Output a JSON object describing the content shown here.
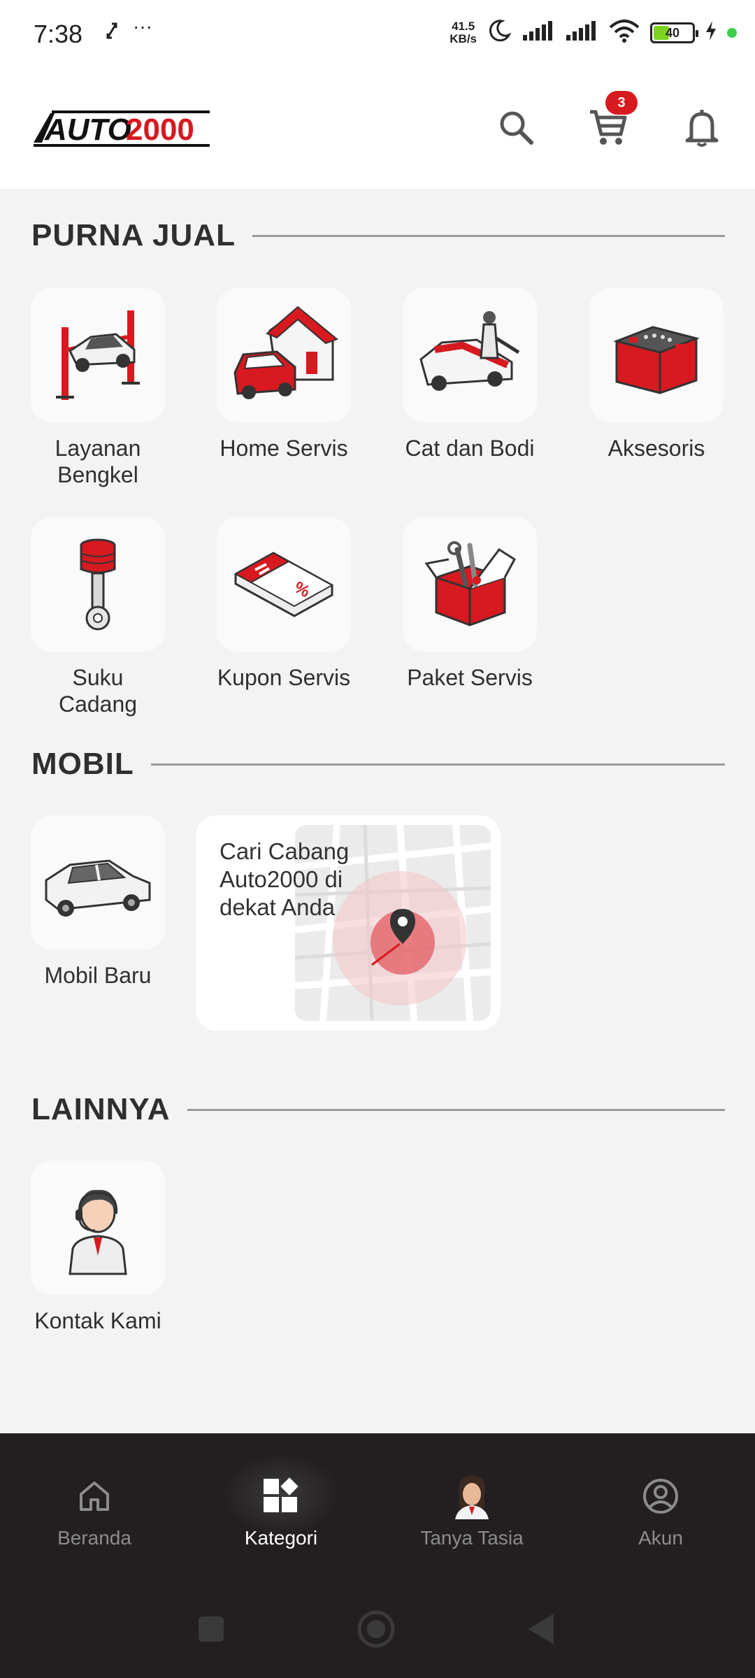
{
  "status_bar": {
    "time": "7:38",
    "net_speed_value": "41.5",
    "net_speed_unit": "KB/s",
    "battery": "40"
  },
  "header": {
    "logo_text_1": "AUTO",
    "logo_text_2": "2000",
    "cart_count": "3",
    "brand_color": "#d71920"
  },
  "sections": {
    "purna_jual": {
      "title": "PURNA JUAL",
      "items": [
        {
          "label": "Layanan Bengkel",
          "icon": "car-lift-icon"
        },
        {
          "label": "Home Servis",
          "icon": "home-service-icon"
        },
        {
          "label": "Cat dan Bodi",
          "icon": "car-paint-icon"
        },
        {
          "label": "Aksesoris",
          "icon": "battery-icon"
        },
        {
          "label": "Suku Cadang",
          "icon": "piston-icon"
        },
        {
          "label": "Kupon Servis",
          "icon": "coupon-icon"
        },
        {
          "label": "Paket Servis",
          "icon": "toolbox-icon"
        }
      ]
    },
    "mobil": {
      "title": "MOBIL",
      "items": [
        {
          "label": "Mobil Baru",
          "icon": "new-car-icon"
        }
      ],
      "map_card": {
        "text": "Cari Cabang Auto2000 di dekat Anda"
      }
    },
    "lainnya": {
      "title": "LAINNYA",
      "items": [
        {
          "label": "Kontak Kami",
          "icon": "customer-service-icon"
        }
      ]
    }
  },
  "bottom_nav": {
    "items": [
      {
        "label": "Beranda",
        "icon": "home-icon",
        "active": false
      },
      {
        "label": "Kategori",
        "icon": "grid-icon",
        "active": true
      },
      {
        "label": "Tanya Tasia",
        "icon": "assistant-avatar-icon",
        "active": false
      },
      {
        "label": "Akun",
        "icon": "account-icon",
        "active": false
      }
    ]
  }
}
